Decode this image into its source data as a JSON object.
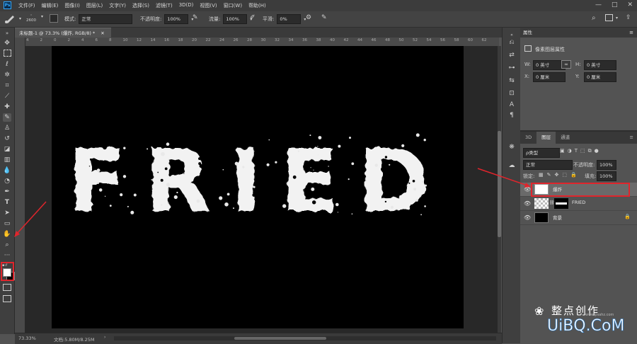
{
  "app": {
    "logo": "Ps"
  },
  "menu": [
    "文件(F)",
    "编辑(E)",
    "图像(I)",
    "图层(L)",
    "文字(Y)",
    "选择(S)",
    "滤镜(T)",
    "3D(D)",
    "视图(V)",
    "窗口(W)",
    "帮助(H)"
  ],
  "options": {
    "brush_size": "2600",
    "mode_label": "模式:",
    "mode_value": "正常",
    "opacity_label": "不透明度:",
    "opacity_value": "100%",
    "flow_label": "流量:",
    "flow_value": "100%",
    "smooth_label": "平滑:",
    "smooth_value": "0%"
  },
  "document": {
    "tab_title": "未标题-1 @ 73.3% (爆炸, RGB/8) *",
    "canvas_text": "FRIED",
    "ruler_numbers": [
      "4",
      "2",
      "0",
      "2",
      "4",
      "6",
      "8",
      "10",
      "12",
      "14",
      "16",
      "18",
      "20",
      "22",
      "24",
      "26",
      "28",
      "30",
      "32",
      "34",
      "36",
      "38",
      "40",
      "42",
      "44",
      "46",
      "48",
      "50",
      "52",
      "54",
      "56",
      "58",
      "60",
      "62"
    ]
  },
  "status": {
    "zoom": "73.33%",
    "doc_info": "文档:5.80M/8.25M"
  },
  "properties": {
    "title": "属性",
    "subtitle": "像素图层属性",
    "w_label": "W:",
    "w_value": "0 英寸",
    "h_label": "H:",
    "h_value": "0 英寸",
    "x_label": "X:",
    "x_value": "0 厘米",
    "y_label": "Y:",
    "y_value": "0 厘米"
  },
  "layers_panel": {
    "tabs": [
      "3D",
      "图层",
      "通道"
    ],
    "active_tab": "图层",
    "filter_value": "ρ类型",
    "blend_mode": "正常",
    "opacity_label": "不透明度:",
    "opacity_value": "100%",
    "lock_label": "锁定:",
    "fill_label": "填充:",
    "fill_value": "100%",
    "layers": [
      {
        "name": "爆炸",
        "selected": true
      },
      {
        "name": "FRIED",
        "selected": false
      },
      {
        "name": "背景",
        "selected": false
      }
    ]
  },
  "watermark": {
    "line1": "整点创作",
    "line2": "UiBQ.CoM",
    "small": "www.psahz.com"
  },
  "colors": {
    "highlight_red": "#e0252c",
    "panel_bg": "#535353",
    "canvas_bg": "#000000"
  }
}
